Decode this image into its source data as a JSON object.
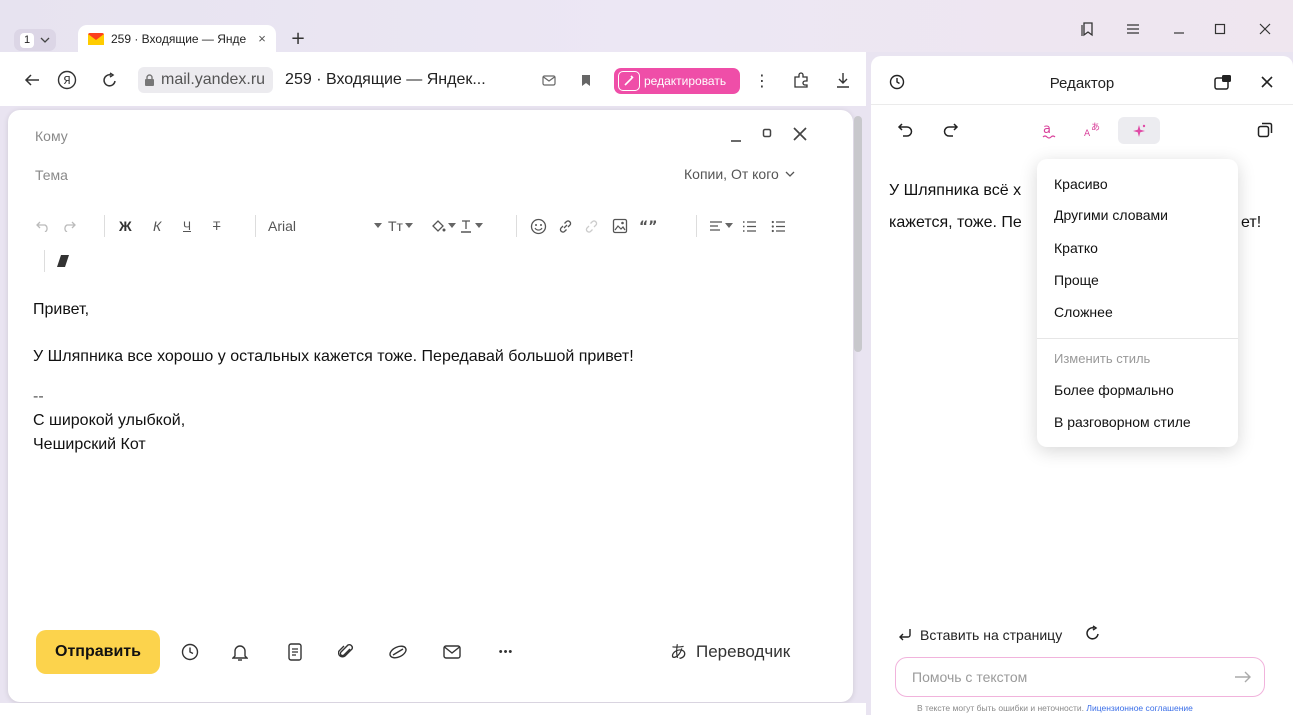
{
  "browser": {
    "tab_count": "1",
    "tab": {
      "title": "259 · Входящие — Янде",
      "close": "×"
    },
    "new_tab": "+",
    "address": {
      "domain": "mail.yandex.ru",
      "page_title": "259 · Входящие — Яндек..."
    },
    "edit_button_label": "редактировать",
    "menu_dots": "⋮",
    "accent": "#ef4ea8"
  },
  "compose": {
    "to_label": "Кому",
    "subject_label": "Тема",
    "copies_label": "Копии, От кого",
    "toolbar": {
      "bold": "Ж",
      "italic": "К",
      "underline": "Ч",
      "strike": "Т",
      "font": "Arial",
      "font_size": "Тт"
    },
    "body": {
      "greeting": "Привет,",
      "main": "У Шляпника все хорошо у остальных кажется тоже. Передавай большой привет!",
      "sig_dash": "--",
      "sig_line1": "С широкой улыбкой,",
      "sig_line2": "Чеширский Кот"
    },
    "send_label": "Отправить",
    "translator_label": "Переводчик",
    "more_label": "•••",
    "send_color": "#fcd34c"
  },
  "editor": {
    "title": "Редактор",
    "text_line1": "У Шляпника всё х",
    "text_line2": "кажется, тоже. Пе",
    "text_tail": "ет!",
    "insert_label": "Вставить на страницу",
    "help_placeholder": "Помочь с текстом",
    "disclaimer": "В тексте могут быть ошибки и неточности.",
    "disclaimer_link": "Лицензионное соглашение"
  },
  "dropdown": {
    "items": [
      "Красиво",
      "Другими словами",
      "Кратко",
      "Проще",
      "Сложнее"
    ],
    "style_header": "Изменить стиль",
    "style_items": [
      "Более формально",
      "В разговорном стиле"
    ]
  }
}
